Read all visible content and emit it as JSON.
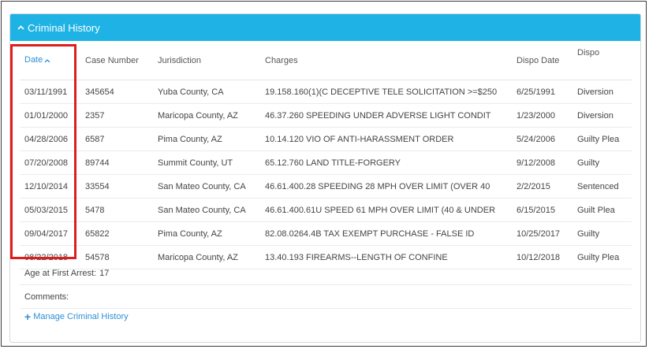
{
  "panel": {
    "title": "Criminal History"
  },
  "table": {
    "headers": {
      "date": "Date",
      "case_number": "Case Number",
      "jurisdiction": "Jurisdiction",
      "charges": "Charges",
      "dispo_date": "Dispo Date",
      "dispo": "Dispo"
    },
    "sort_column": "date",
    "sort_direction": "ascending",
    "rows": [
      {
        "date": "03/11/1991",
        "case_number": "345654",
        "jurisdiction": "Yuba County, CA",
        "charges": "19.158.160(1)(C DECEPTIVE TELE SOLICITATION >=$250",
        "dispo_date": "6/25/1991",
        "dispo": "Diversion"
      },
      {
        "date": "01/01/2000",
        "case_number": "2357",
        "jurisdiction": "Maricopa County, AZ",
        "charges": "46.37.260 SPEEDING UNDER ADVERSE LIGHT CONDIT",
        "dispo_date": "1/23/2000",
        "dispo": "Diversion"
      },
      {
        "date": "04/28/2006",
        "case_number": "6587",
        "jurisdiction": "Pima County, AZ",
        "charges": "10.14.120 VIO OF ANTI-HARASSMENT ORDER",
        "dispo_date": "5/24/2006",
        "dispo": "Guilty Plea"
      },
      {
        "date": "07/20/2008",
        "case_number": "89744",
        "jurisdiction": "Summit County, UT",
        "charges": "65.12.760 LAND TITLE-FORGERY",
        "dispo_date": "9/12/2008",
        "dispo": "Guilty"
      },
      {
        "date": "12/10/2014",
        "case_number": "33554",
        "jurisdiction": "San Mateo County, CA",
        "charges": "46.61.400.28 SPEEDING 28 MPH OVER LIMIT (OVER 40",
        "dispo_date": "2/2/2015",
        "dispo": "Sentenced"
      },
      {
        "date": "05/03/2015",
        "case_number": "5478",
        "jurisdiction": "San Mateo County, CA",
        "charges": "46.61.400.61U SPEED 61 MPH OVER LIMIT (40 & UNDER",
        "dispo_date": "6/15/2015",
        "dispo": "Guilt Plea"
      },
      {
        "date": "09/04/2017",
        "case_number": "65822",
        "jurisdiction": "Pima County, AZ",
        "charges": "82.08.0264.4B TAX EXEMPT PURCHASE - FALSE ID",
        "dispo_date": "10/25/2017",
        "dispo": "Guilty"
      },
      {
        "date": "08/22/2018",
        "case_number": "54578",
        "jurisdiction": "Maricopa County, AZ",
        "charges": "13.40.193 FIREARMS--LENGTH OF CONFINE",
        "dispo_date": "10/12/2018",
        "dispo": "Guilty Plea"
      }
    ]
  },
  "age_at_first_arrest": {
    "label": "Age at First Arrest:",
    "value": "17"
  },
  "comments": {
    "label": "Comments:",
    "value": ""
  },
  "manage_link": {
    "label": "Manage Criminal History"
  },
  "colors": {
    "header_bg": "#1eb3e4",
    "link": "#2f8fd6",
    "highlight_border": "#e01d1d"
  },
  "icons": {
    "header_toggle": "chevron-up-icon",
    "sort_indicator": "caret-up-icon",
    "manage": "plus-icon"
  }
}
